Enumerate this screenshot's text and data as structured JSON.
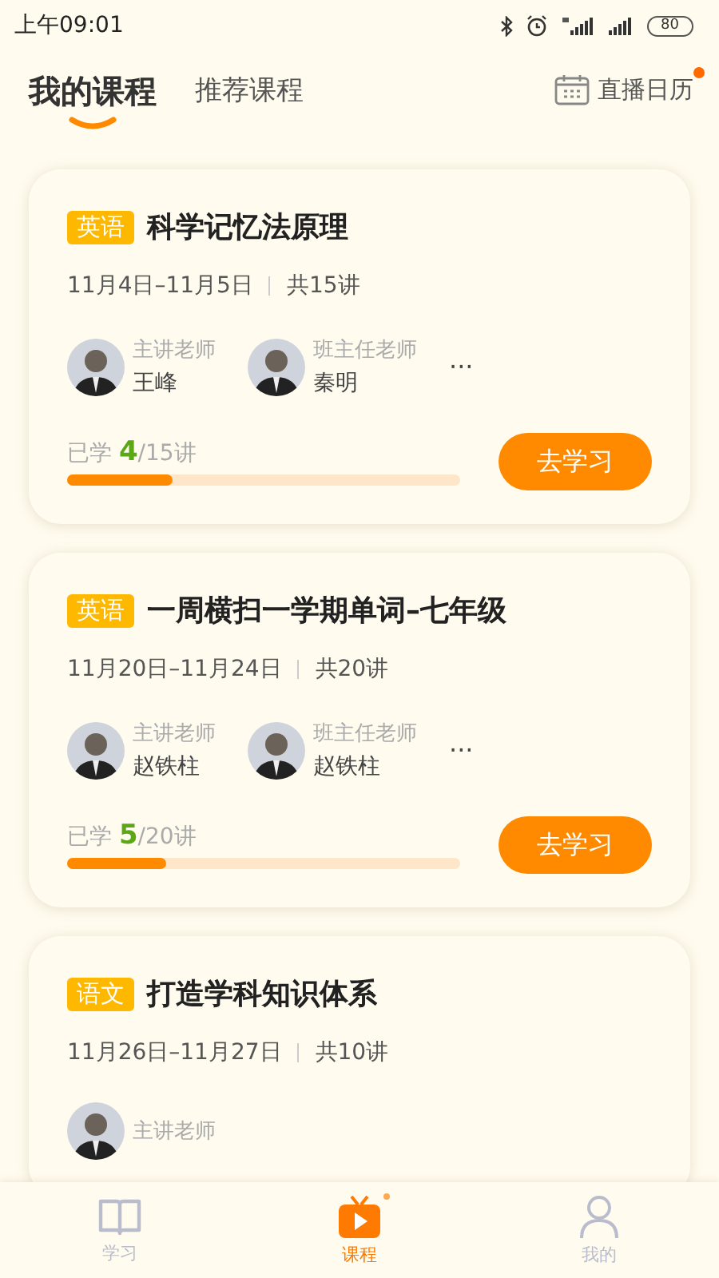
{
  "status_bar": {
    "time": "上午09:01",
    "battery": "80"
  },
  "header": {
    "tabs": [
      {
        "label": "我的课程",
        "selected": true
      },
      {
        "label": "推荐课程",
        "selected": false
      }
    ],
    "calendar": {
      "label": "直播日历",
      "badge": true
    }
  },
  "courses": [
    {
      "subject": "英语",
      "title": "科学记忆法原理",
      "dates": "11月4日–11月5日",
      "total": "共15讲",
      "teachers": [
        {
          "role": "主讲老师",
          "name": "王峰"
        },
        {
          "role": "班主任老师",
          "name": "秦明"
        }
      ],
      "more": "···",
      "progress": {
        "prefix": "已学",
        "done": "4",
        "rest": "/15讲",
        "level": 0.267
      },
      "button": "去学习"
    },
    {
      "subject": "英语",
      "title": "一周横扫一学期单词–七年级",
      "dates": "11月20日–11月24日",
      "total": "共20讲",
      "teachers": [
        {
          "role": "主讲老师",
          "name": "赵铁柱"
        },
        {
          "role": "班主任老师",
          "name": "赵铁柱"
        }
      ],
      "more": "···",
      "progress": {
        "prefix": "已学",
        "done": "5",
        "rest": "/20讲",
        "level": 0.25
      },
      "button": "去学习"
    },
    {
      "subject": "语文",
      "title": "打造学科知识体系",
      "dates": "11月26日–11月27日",
      "total": "共10讲",
      "teachers": [
        {
          "role": "主讲老师"
        }
      ]
    }
  ],
  "tab_bar": [
    {
      "label": "学习",
      "kind": "book",
      "selected": false,
      "badge": false
    },
    {
      "label": "课程",
      "kind": "play",
      "selected": true,
      "badge": true
    },
    {
      "label": "我的",
      "kind": "person",
      "selected": false,
      "badge": false
    }
  ]
}
